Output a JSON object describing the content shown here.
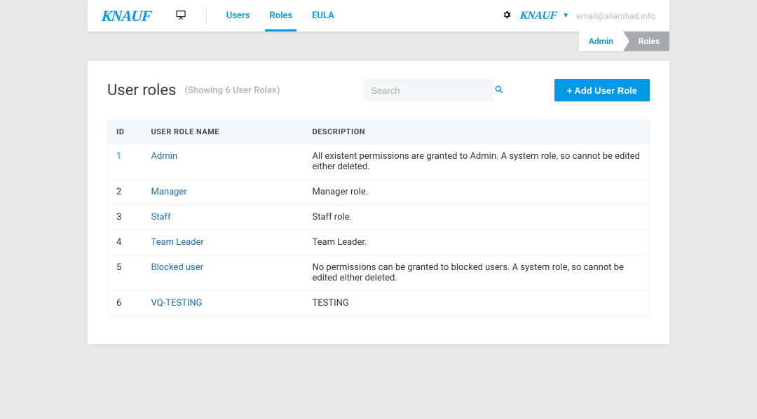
{
  "header": {
    "logo_text": "KNAUF",
    "nav": {
      "users": "Users",
      "roles": "Roles",
      "eula": "EULA"
    },
    "logo_small": "KNAUF",
    "user_email": "email@aliarshad.info"
  },
  "breadcrumb": {
    "admin": "Admin",
    "roles": "Roles"
  },
  "page": {
    "title": "User roles",
    "subtitle": "(Showing 6 User Roles)",
    "search_placeholder": "Search",
    "add_button": "+ Add User Role"
  },
  "table": {
    "columns": {
      "id": "ID",
      "name": "USER ROLE NAME",
      "desc": "DESCRIPTION"
    },
    "rows": [
      {
        "id": "1",
        "name": "Admin",
        "desc": "All existent permissions are granted to Admin. A system role, so cannot be edited either deleted."
      },
      {
        "id": "2",
        "name": "Manager",
        "desc": "Manager role."
      },
      {
        "id": "3",
        "name": "Staff",
        "desc": "Staff role."
      },
      {
        "id": "4",
        "name": "Team Leader",
        "desc": "Team Leader."
      },
      {
        "id": "5",
        "name": "Blocked user",
        "desc": "No permissions can be granted to blocked users. A system role, so cannot be edited either deleted."
      },
      {
        "id": "6",
        "name": "VQ-TESTING",
        "desc": "TESTING"
      }
    ]
  }
}
